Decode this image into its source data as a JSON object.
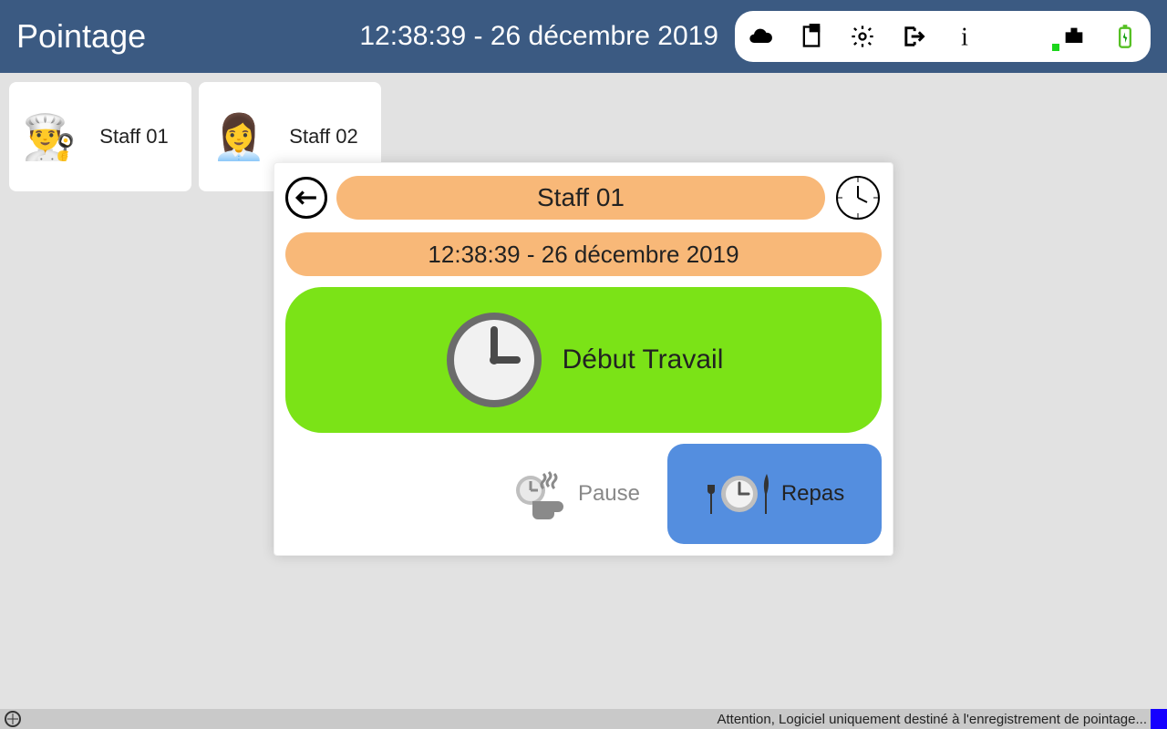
{
  "header": {
    "title": "Pointage",
    "datetime": "12:38:39 - 26 décembre 2019"
  },
  "staff": [
    {
      "name": "Staff 01",
      "avatar_emoji": "👨‍🍳"
    },
    {
      "name": "Staff 02",
      "avatar_emoji": "👩‍💼"
    }
  ],
  "dialog": {
    "selected_staff": "Staff 01",
    "datetime": "12:38:39 - 26 décembre 2019",
    "start_label": "Début Travail",
    "pause_label": "Pause",
    "meal_label": "Repas"
  },
  "footer": {
    "warning": "Attention, Logiciel uniquement destiné à l'enregistrement de pointage..."
  },
  "colors": {
    "topbar": "#3b5a82",
    "pill": "#f8b878",
    "start": "#7be317",
    "meal": "#548edf",
    "footer_accent": "#1500ff"
  }
}
